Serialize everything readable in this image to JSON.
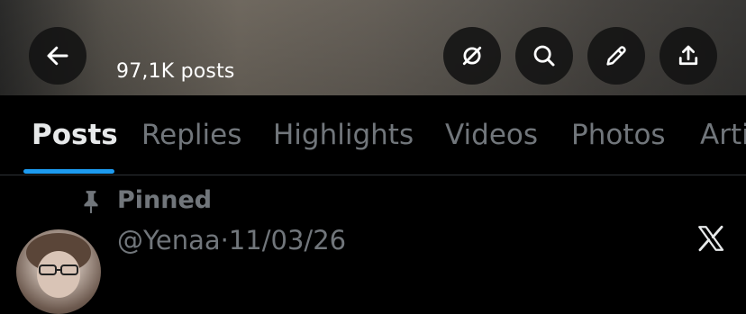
{
  "header": {
    "posts_count": "97,1K posts",
    "buttons": {
      "back": "arrow-left-icon",
      "grok": "slashed-circle-icon",
      "search": "search-icon",
      "edit": "pencil-icon",
      "share": "share-icon"
    }
  },
  "tabs": [
    {
      "label": "Posts",
      "active": true
    },
    {
      "label": "Replies",
      "active": false
    },
    {
      "label": "Highlights",
      "active": false
    },
    {
      "label": "Videos",
      "active": false
    },
    {
      "label": "Photos",
      "active": false
    },
    {
      "label": "Arti",
      "active": false
    }
  ],
  "pinned": {
    "label": "Pinned",
    "handle": "@Yenaa",
    "separator": "·",
    "date": "11/03/26"
  },
  "colors": {
    "accent": "#1d9bf0",
    "muted_text": "#71767b",
    "primary_text": "#e7e9ea"
  }
}
